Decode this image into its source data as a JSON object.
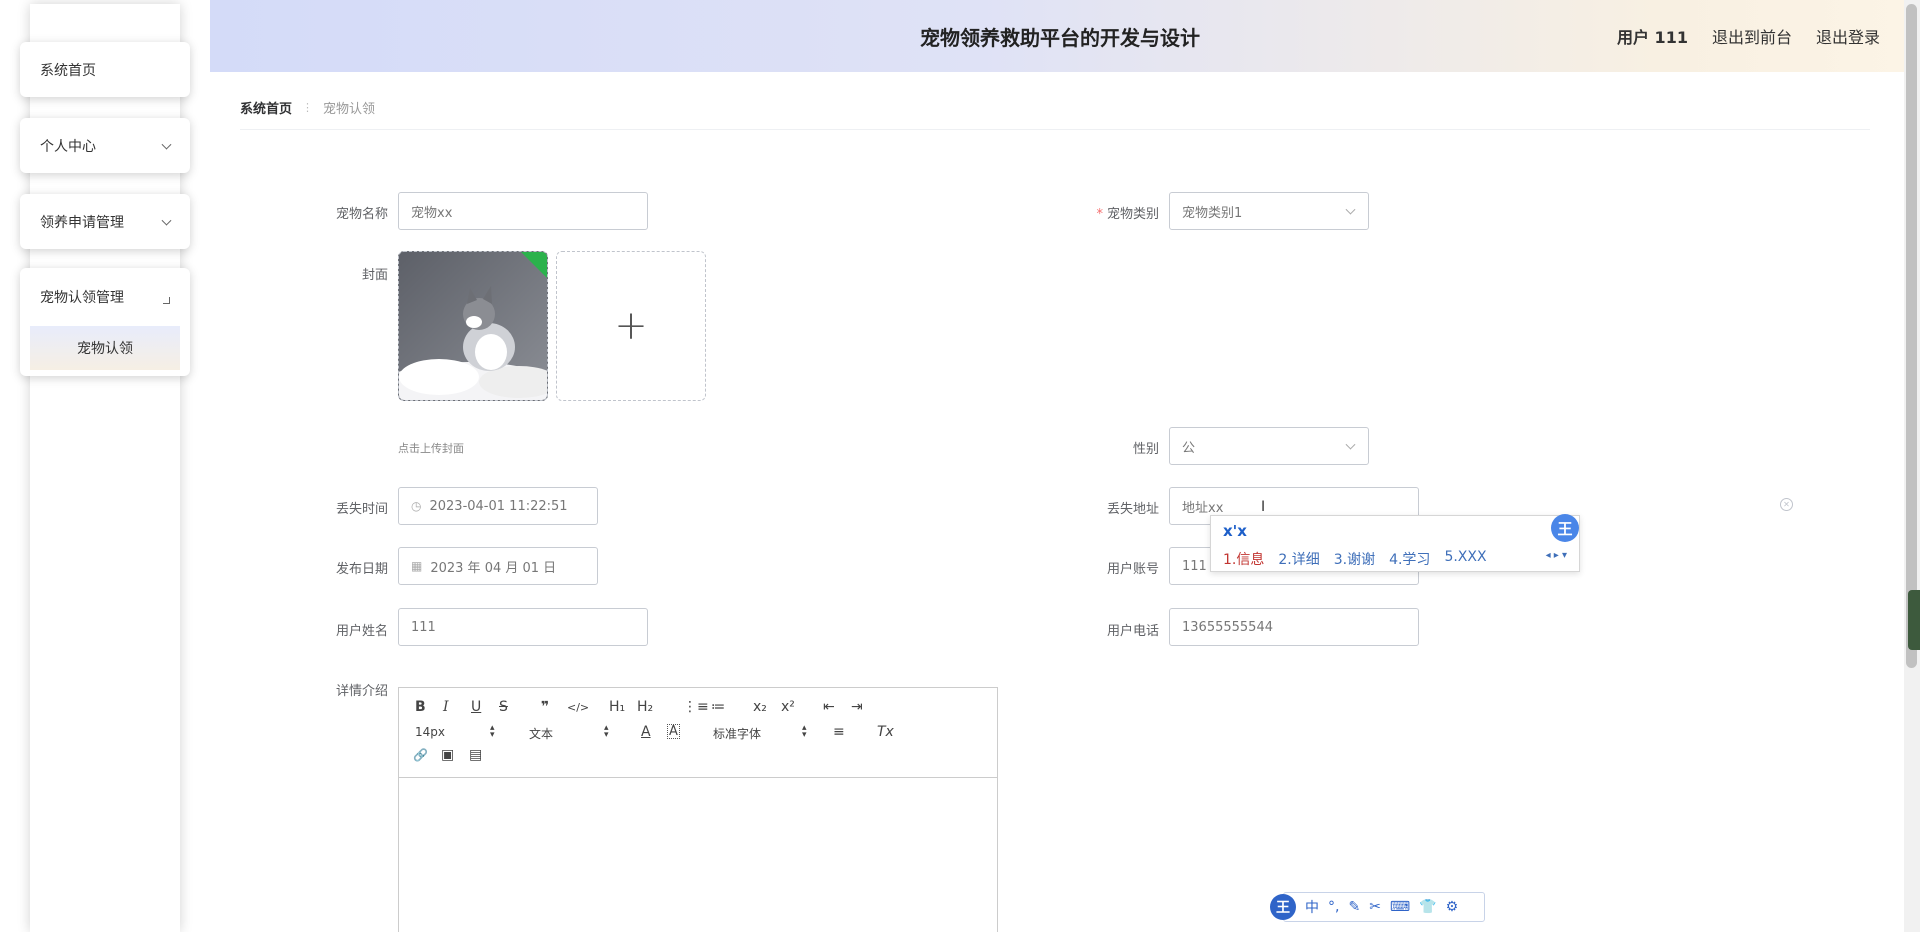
{
  "header": {
    "title": "宠物领养救助平台的开发与设计",
    "user": "用户 111",
    "to_front": "退出到前台",
    "logout": "退出登录"
  },
  "sidebar": {
    "home": "系统首页",
    "personal": "个人中心",
    "adoption_mgmt": "领养申请管理",
    "claim_mgmt": "宠物认领管理",
    "claim": "宠物认领"
  },
  "breadcrumb": {
    "home": "系统首页",
    "sep": "⋮",
    "current": "宠物认领"
  },
  "form": {
    "pet_name": {
      "label": "宠物名称",
      "value": "宠物xx"
    },
    "pet_category": {
      "label": "宠物类别",
      "value": "宠物类别1"
    },
    "cover": {
      "label": "封面",
      "hint": "点击上传封面"
    },
    "gender": {
      "label": "性别",
      "value": "公"
    },
    "lost_time": {
      "label": "丢失时间",
      "value": "2023-04-01 11:22:51"
    },
    "lost_address": {
      "label": "丢失地址",
      "value": "地址xx"
    },
    "publish_date": {
      "label": "发布日期",
      "value": "2023 年 04 月 01 日"
    },
    "user_account": {
      "label": "用户账号",
      "value": "111"
    },
    "user_name": {
      "label": "用户姓名",
      "value": "111"
    },
    "user_phone": {
      "label": "用户电话",
      "value": "13655555544"
    },
    "detail": {
      "label": "详情介绍"
    }
  },
  "editor": {
    "bold": "B",
    "italic": "I",
    "underline": "U",
    "strike": "S",
    "quote": "❞",
    "code": "</>",
    "h1": "H₁",
    "h2": "H₂",
    "ol": "⋮≡",
    "ul": "≔",
    "sub": "x₂",
    "sup": "x²",
    "outdent": "⇤",
    "indent": "⇥",
    "size": "14px",
    "para": "文本",
    "color": "A",
    "bg": "A",
    "font": "标准字体",
    "align": "≡",
    "clear": "Tx",
    "link": "🔗",
    "image": "▣",
    "video": "▤"
  },
  "ime": {
    "composition": "x'x",
    "candidates": [
      "1.信息",
      "2.详细",
      "3.谢谢",
      "4.学习",
      "5.XXX"
    ],
    "nav": "◂ ▸ ▾",
    "badge": "王",
    "bar": [
      "中",
      "°,",
      "✎",
      "✂",
      "⌨",
      "👕",
      "⚙"
    ]
  },
  "colors": {
    "header_left": "#d4dbf8",
    "header_right": "#fcf4e6",
    "required": "#f56c6c",
    "ime_blue": "#2f64c8"
  }
}
